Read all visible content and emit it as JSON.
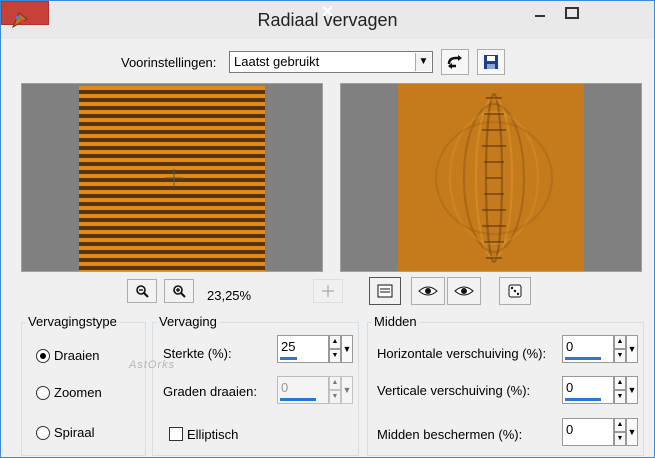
{
  "window": {
    "title": "Radiaal vervagen",
    "close_glyph": "✕",
    "min_glyph": "—",
    "max_glyph": "☐"
  },
  "presets": {
    "label": "Voorinstellingen:",
    "value": "Laatst gebruikt"
  },
  "zoom": {
    "level": "23,25%"
  },
  "watermark": "AstOrks",
  "type_group": {
    "title": "Vervagingstype",
    "options": [
      "Draaien",
      "Zoomen",
      "Spiraal"
    ],
    "selected": "Draaien"
  },
  "blur_group": {
    "title": "Vervaging",
    "strength_label": "Sterkte (%):",
    "strength_value": "25",
    "rotate_label": "Graden draaien:",
    "rotate_value": "0",
    "elliptical_label": "Elliptisch",
    "elliptical_checked": false
  },
  "center_group": {
    "title": "Midden",
    "horizontal_label": "Horizontale verschuiving (%):",
    "horizontal_value": "0",
    "vertical_label": "Verticale verschuiving (%):",
    "vertical_value": "0",
    "protect_label": "Midden beschermen (%):",
    "protect_value": "0"
  },
  "colors": {
    "accent": "#2a78d6",
    "close": "#c7403a",
    "stripe_light": "#e08a1a",
    "stripe_dark": "#5a3410"
  }
}
